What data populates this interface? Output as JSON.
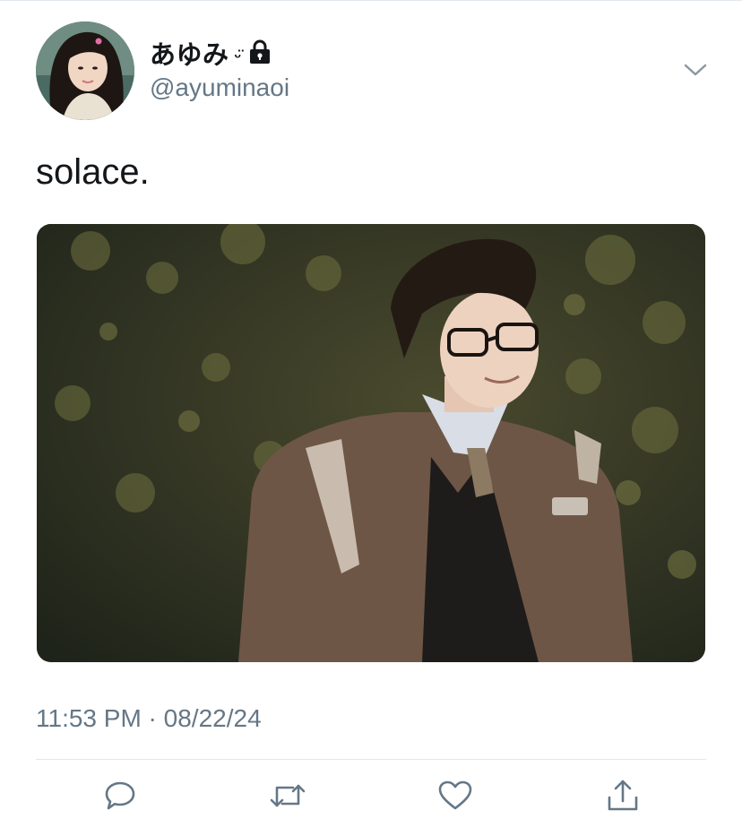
{
  "tweet": {
    "author": {
      "display_name": "あゆみ",
      "emoticon": "ᵕ̈",
      "handle": "@ayuminaoi",
      "protected_icon": "lock-icon"
    },
    "text": "solace.",
    "timestamp": "11:53 PM · 08/22/24",
    "media": {
      "icon": "photo"
    }
  },
  "actions": [
    {
      "name": "reply",
      "icon": "speech-bubble-icon"
    },
    {
      "name": "retweet",
      "icon": "retweet-icon"
    },
    {
      "name": "like",
      "icon": "heart-icon"
    },
    {
      "name": "share",
      "icon": "share-icon"
    }
  ],
  "colors": {
    "text_primary": "#14171a",
    "text_secondary": "#657786",
    "divider": "#e1e8ed",
    "icon": "#657786"
  }
}
